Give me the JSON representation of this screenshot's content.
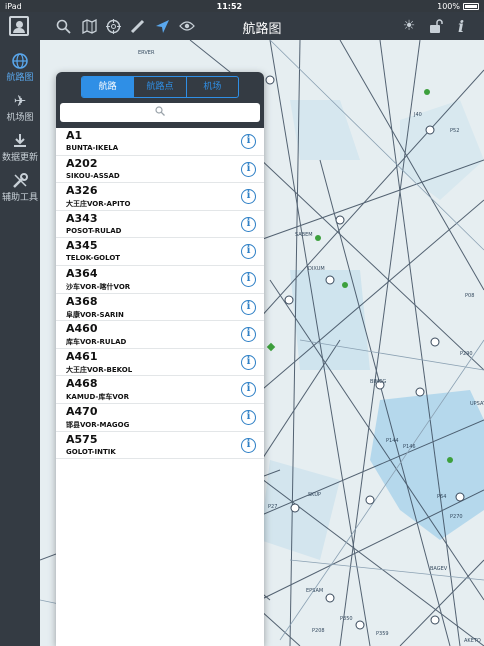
{
  "status": {
    "device": "iPad",
    "time": "11:52",
    "battery": "100%"
  },
  "rail": {
    "items": [
      {
        "label": "航路图",
        "icon": "globe-icon"
      },
      {
        "label": "机场图",
        "icon": "airplane-icon"
      },
      {
        "label": "数据更新",
        "icon": "download-icon"
      },
      {
        "label": "辅助工具",
        "icon": "tools-icon"
      }
    ]
  },
  "topbar": {
    "title": "航路图"
  },
  "panel": {
    "tabs": [
      "航路",
      "航路点",
      "机场"
    ],
    "active_tab": "航路",
    "search_placeholder": "",
    "routes": [
      {
        "code": "A1",
        "route": "BUNTA-IKELA"
      },
      {
        "code": "A202",
        "route": "SIKOU-ASSAD"
      },
      {
        "code": "A326",
        "route": "大王庄VOR-APITO"
      },
      {
        "code": "A343",
        "route": "POSOT-RULAD"
      },
      {
        "code": "A345",
        "route": "TELOK-GOLOT"
      },
      {
        "code": "A364",
        "route": "沙车VOR-喀什VOR"
      },
      {
        "code": "A368",
        "route": "阜康VOR-SARIN"
      },
      {
        "code": "A460",
        "route": "库车VOR-RULAD"
      },
      {
        "code": "A461",
        "route": "大王庄VOR-BEKOL"
      },
      {
        "code": "A468",
        "route": "KAMUD-库车VOR"
      },
      {
        "code": "A470",
        "route": "邯县VOR-MAGOG"
      },
      {
        "code": "A575",
        "route": "GOLOT-INTIK"
      }
    ]
  },
  "map": {
    "labels": [
      "ERVER",
      "SABEM",
      "BIMEG",
      "P144",
      "P146",
      "P290",
      "P08",
      "P52",
      "P270",
      "P350",
      "P359",
      "P208",
      "P381",
      "P372",
      "EPSAM",
      "BAGEV",
      "AKETO",
      "SKUP",
      "UPSAT",
      "P64",
      "J40",
      "P52",
      "DIXUM",
      "P27"
    ]
  },
  "colors": {
    "accent": "#2f8fe6",
    "rail": "#343b43",
    "map_blue": "#b5d8ec"
  }
}
